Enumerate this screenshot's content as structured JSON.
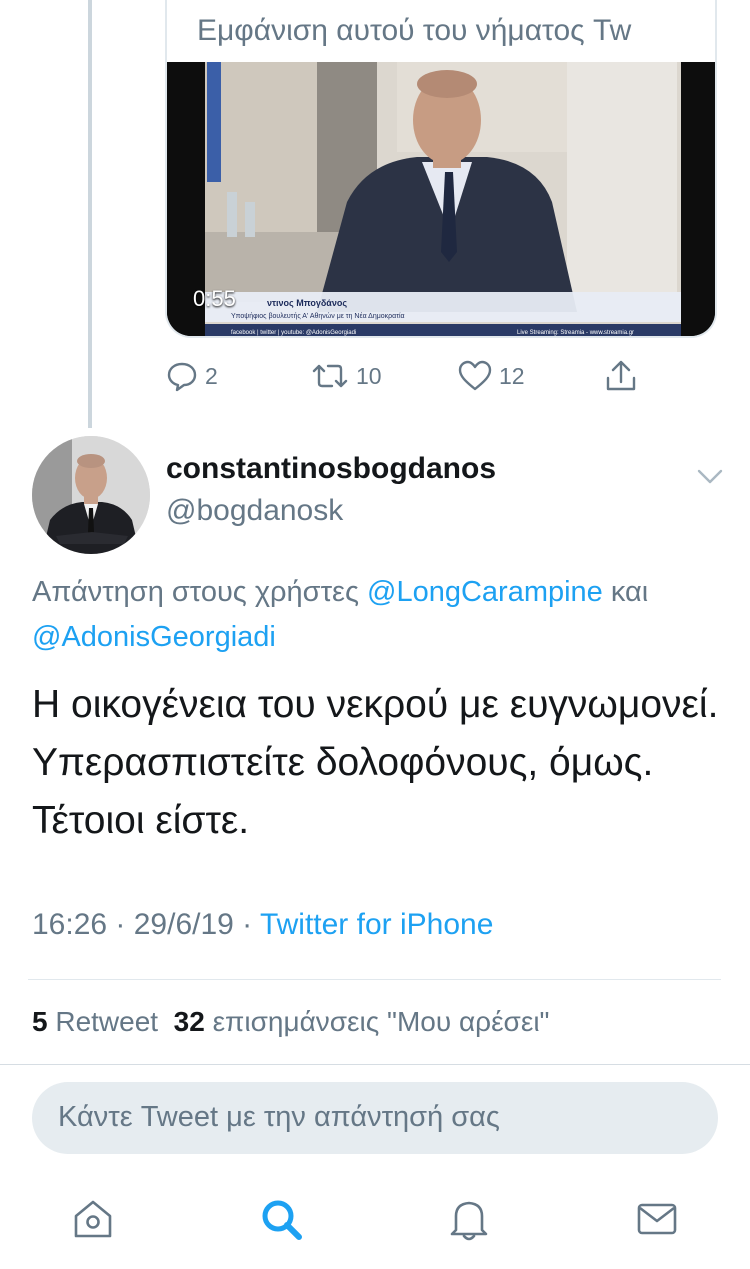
{
  "embedded_card": {
    "title": "Εμφάνιση αυτού του νήματος Tw",
    "video_duration": "0:55",
    "video_caption_name": "ντινος Μπογδάνος",
    "video_caption_sub": "Υποψήφιος βουλευτής Α' Αθηνών με τη Νέα Δημοκρατία",
    "video_caption_bar": "facebook | twitter | youtube: @AdonisGeorgiadi",
    "video_stream": "Live Streaming: Streamia - www.streamia.gr"
  },
  "actions": {
    "replies": "2",
    "retweets": "10",
    "likes": "12"
  },
  "tweet": {
    "display_name": "constantinosbogdanos",
    "handle": "@bogdanosk",
    "reply_prefix": "Απάντηση στους χρήστες ",
    "reply_user1": "@LongCarampine",
    "reply_and": " και ",
    "reply_user2": "@AdonisGeorgiadi",
    "text": "Η οικογένεια του νεκρού με ευγνωμονεί. Υπερασπιστείτε δολοφόνους, όμως. Τέτοιοι είστε.",
    "time": "16:26 · 29/6/19 · ",
    "source": "Twitter for iPhone"
  },
  "stats": {
    "retweet_count": "5",
    "retweet_label": " Retweet  ",
    "like_count": "32",
    "like_label": " επισημάνσεις \"Μου αρέσει\""
  },
  "reply_box": {
    "placeholder": "Κάντε Tweet με την απάντησή σας"
  },
  "tabbar": {
    "icons": [
      "home-icon",
      "search-icon",
      "notifications-icon",
      "messages-icon"
    ],
    "active": "search-icon"
  },
  "colors": {
    "accent": "#1da1f2",
    "secondary_text": "#657786",
    "primary_text": "#14171a"
  }
}
